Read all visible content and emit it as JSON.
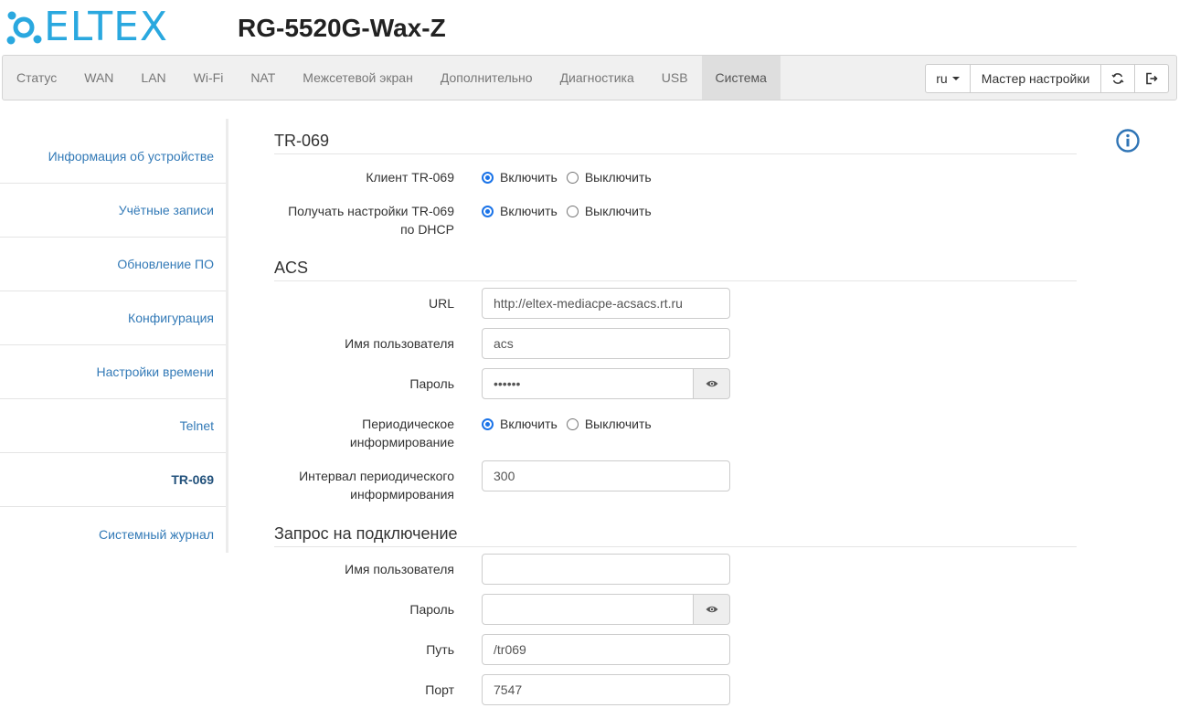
{
  "header": {
    "logo_text": "ELTEX",
    "device_title": "RG-5520G-Wax-Z"
  },
  "nav": {
    "items": [
      "Статус",
      "WAN",
      "LAN",
      "Wi-Fi",
      "NAT",
      "Межсетевой экран",
      "Дополнительно",
      "Диагностика",
      "USB",
      "Система"
    ],
    "active": "Система",
    "lang": "ru",
    "wizard": "Мастер настройки"
  },
  "sidebar": {
    "items": [
      "Информация об устройстве",
      "Учётные записи",
      "Обновление ПО",
      "Конфигурация",
      "Настройки времени",
      "Telnet",
      "TR-069",
      "Системный журнал"
    ],
    "active": "TR-069"
  },
  "tr069": {
    "title": "TR-069",
    "client_label": "Клиент TR-069",
    "dhcp_label_line1": "Получать настройки TR-069",
    "dhcp_label_line2": "по DHCP",
    "enable": "Включить",
    "disable": "Выключить",
    "client_value": "enable",
    "dhcp_value": "enable"
  },
  "acs": {
    "title": "ACS",
    "url_label": "URL",
    "url_value": "http://eltex-mediacpe-acsacs.rt.ru",
    "username_label": "Имя пользователя",
    "username_value": "acs",
    "password_label": "Пароль",
    "password_value": "••••••",
    "periodic_label_line1": "Периодическое",
    "periodic_label_line2": "информирование",
    "periodic_value": "enable",
    "interval_label_line1": "Интервал периодического",
    "interval_label_line2": "информирования",
    "interval_value": "300"
  },
  "connection_request": {
    "title": "Запрос на подключение",
    "username_label": "Имя пользователя",
    "username_value": "",
    "password_label": "Пароль",
    "password_value": "",
    "path_label": "Путь",
    "path_value": "/tr069",
    "port_label": "Порт",
    "port_value": "7547"
  },
  "colors": {
    "brand": "#2aa8df",
    "link": "#337ab7",
    "radio_checked": "#1a73e8",
    "info_icon": "#2f74b5"
  }
}
